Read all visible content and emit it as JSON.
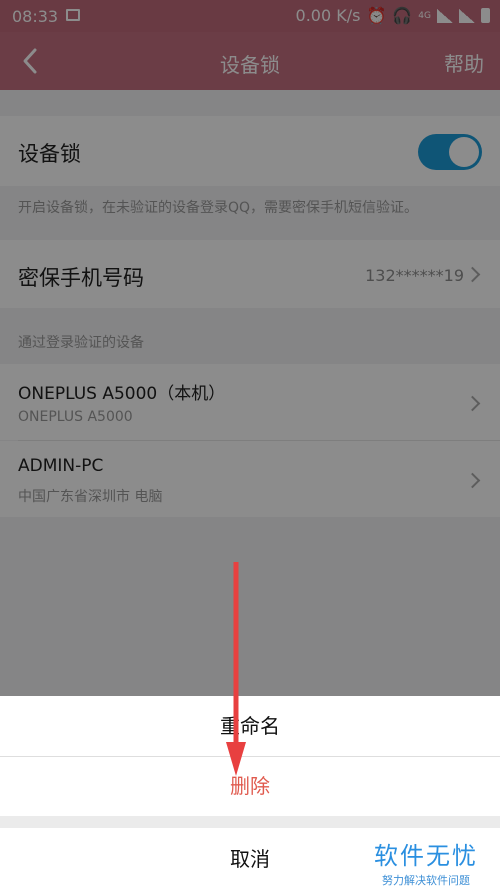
{
  "status_bar": {
    "time": "08:33",
    "net_speed": "0.00 K/s",
    "network_type": "4G"
  },
  "nav": {
    "title": "设备锁",
    "help": "帮助"
  },
  "device_lock": {
    "label": "设备锁",
    "enabled": true,
    "hint": "开启设备锁，在未验证的设备登录QQ，需要密保手机短信验证。"
  },
  "phone": {
    "label": "密保手机号码",
    "value": "132******19"
  },
  "devices_header": "通过登录验证的设备",
  "devices": [
    {
      "name": "ONEPLUS A5000（本机）",
      "detail": "ONEPLUS A5000"
    },
    {
      "name": "ADMIN-PC",
      "detail": "中国广东省深圳市 电脑"
    }
  ],
  "action_sheet": {
    "rename": "重命名",
    "delete": "删除",
    "cancel": "取消"
  },
  "watermark": {
    "title": "软件无忧",
    "subtitle": "努力解决软件问题"
  },
  "colors": {
    "accent": "#1d9bd8",
    "header": "#c36f80",
    "delete": "#e05a4e",
    "annotation": "#e84040"
  }
}
